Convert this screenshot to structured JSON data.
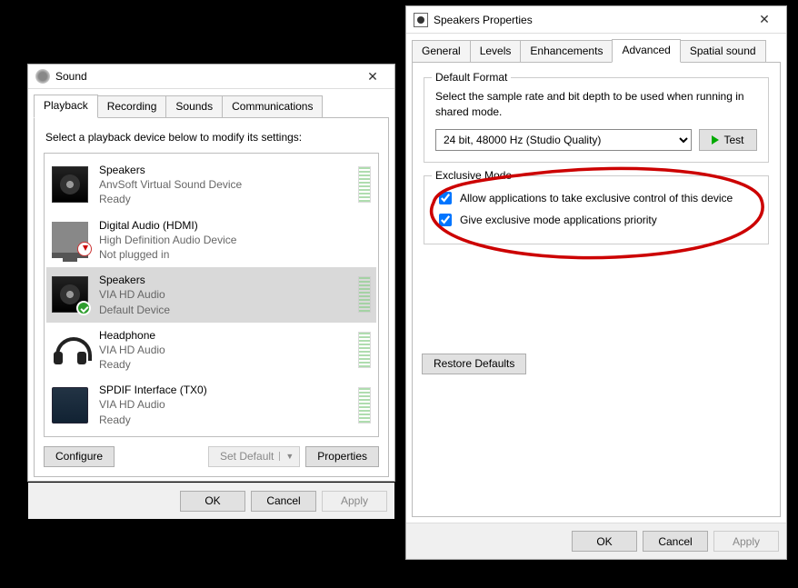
{
  "sound_window": {
    "title": "Sound",
    "tabs": [
      "Playback",
      "Recording",
      "Sounds",
      "Communications"
    ],
    "active_tab": 0,
    "instruction": "Select a playback device below to modify its settings:",
    "devices": [
      {
        "name": "Speakers",
        "desc": "AnvSoft Virtual Sound Device",
        "status": "Ready",
        "icon": "speaker",
        "badge": null
      },
      {
        "name": "Digital Audio (HDMI)",
        "desc": "High Definition Audio Device",
        "status": "Not plugged in",
        "icon": "monitor",
        "badge": "down"
      },
      {
        "name": "Speakers",
        "desc": "VIA HD Audio",
        "status": "Default Device",
        "icon": "speaker",
        "badge": "check"
      },
      {
        "name": "Headphone",
        "desc": "VIA HD Audio",
        "status": "Ready",
        "icon": "headphone",
        "badge": null
      },
      {
        "name": "SPDIF Interface (TX0)",
        "desc": "VIA HD Audio",
        "status": "Ready",
        "icon": "spdif",
        "badge": null
      }
    ],
    "selected_index": 2,
    "buttons": {
      "configure": "Configure",
      "set_default": "Set Default",
      "properties": "Properties",
      "ok": "OK",
      "cancel": "Cancel",
      "apply": "Apply"
    }
  },
  "props_window": {
    "title": "Speakers Properties",
    "tabs": [
      "General",
      "Levels",
      "Enhancements",
      "Advanced",
      "Spatial sound"
    ],
    "active_tab": 3,
    "default_format": {
      "legend": "Default Format",
      "desc": "Select the sample rate and bit depth to be used when running in shared mode.",
      "selected": "24 bit, 48000 Hz (Studio Quality)",
      "test": "Test"
    },
    "exclusive_mode": {
      "legend": "Exclusive Mode",
      "allow_label": "Allow applications to take exclusive control of this device",
      "allow_checked": true,
      "priority_label": "Give exclusive mode applications priority",
      "priority_checked": true
    },
    "restore_defaults": "Restore Defaults",
    "buttons": {
      "ok": "OK",
      "cancel": "Cancel",
      "apply": "Apply"
    }
  }
}
